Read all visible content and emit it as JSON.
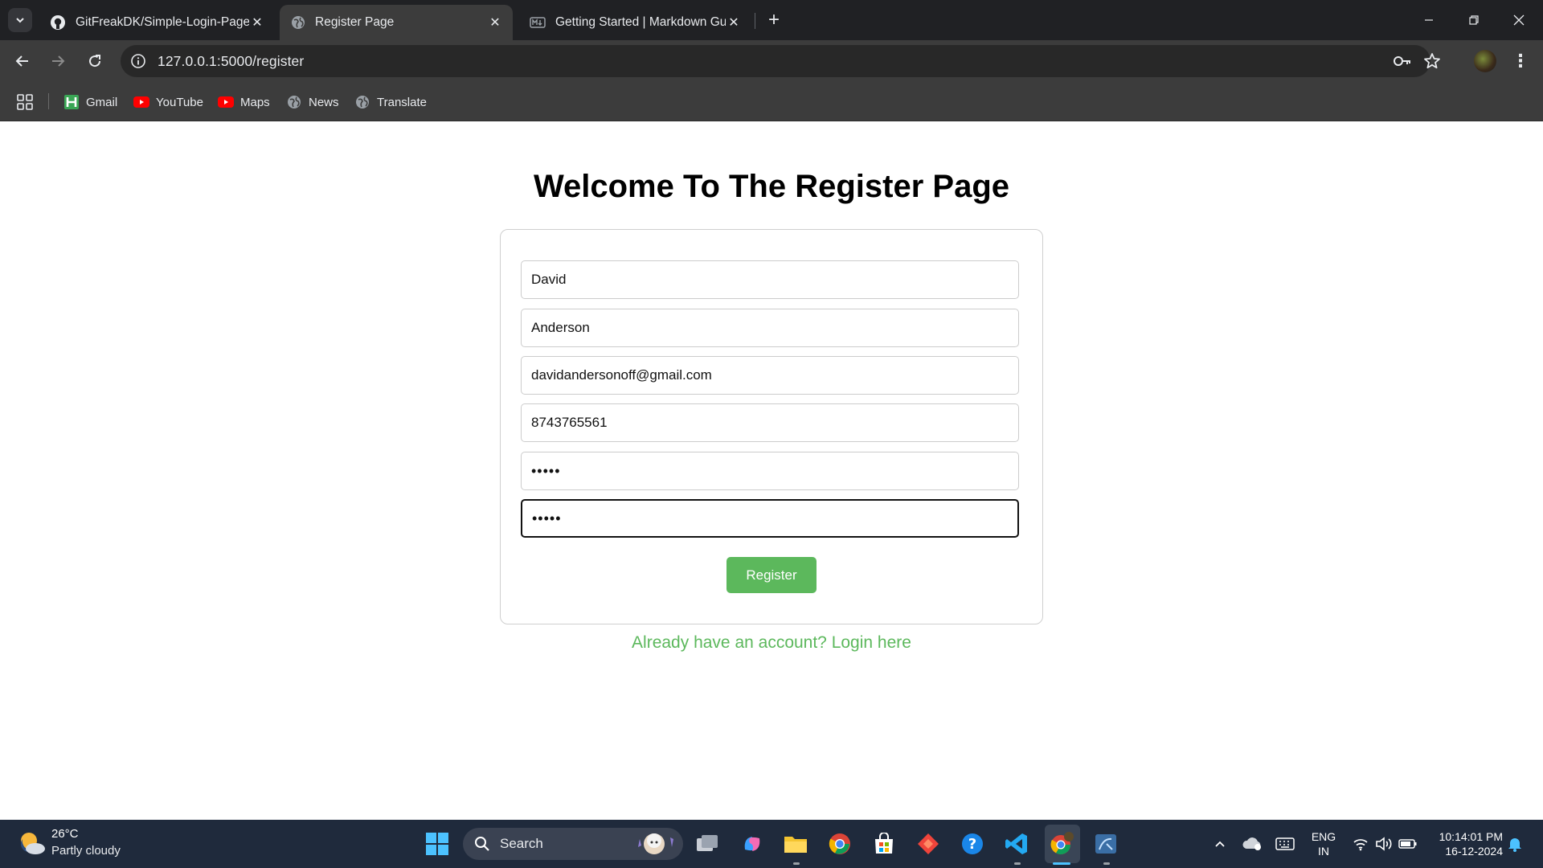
{
  "browser": {
    "tabs": [
      {
        "title": "GitFreakDK/Simple-Login-Page",
        "icon": "github-icon",
        "active": false
      },
      {
        "title": "Register Page",
        "icon": "globe-icon",
        "active": true
      },
      {
        "title": "Getting Started | Markdown Gu",
        "icon": "markdown-icon",
        "active": false
      }
    ],
    "url": "127.0.0.1:5000/register",
    "bookmarks": [
      {
        "label": "Gmail",
        "icon": "gmail-icon"
      },
      {
        "label": "YouTube",
        "icon": "youtube-icon"
      },
      {
        "label": "Maps",
        "icon": "youtube-icon"
      },
      {
        "label": "News",
        "icon": "globe-icon"
      },
      {
        "label": "Translate",
        "icon": "globe-icon"
      }
    ]
  },
  "page": {
    "title": "Welcome To The Register Page",
    "fields": {
      "first_name": "David",
      "last_name": "Anderson",
      "email": "davidandersonoff@gmail.com",
      "phone": "8743765561",
      "password": "•••••",
      "confirm_password": "•••••"
    },
    "register_label": "Register",
    "login_link": "Already have an account? Login here",
    "colors": {
      "accent": "#5cb85c"
    }
  },
  "taskbar": {
    "weather_temp": "26°C",
    "weather_desc": "Partly cloudy",
    "search_label": "Search",
    "lang_line1": "ENG",
    "lang_line2": "IN",
    "time": "10:14:01 PM",
    "date": "16-12-2024"
  }
}
